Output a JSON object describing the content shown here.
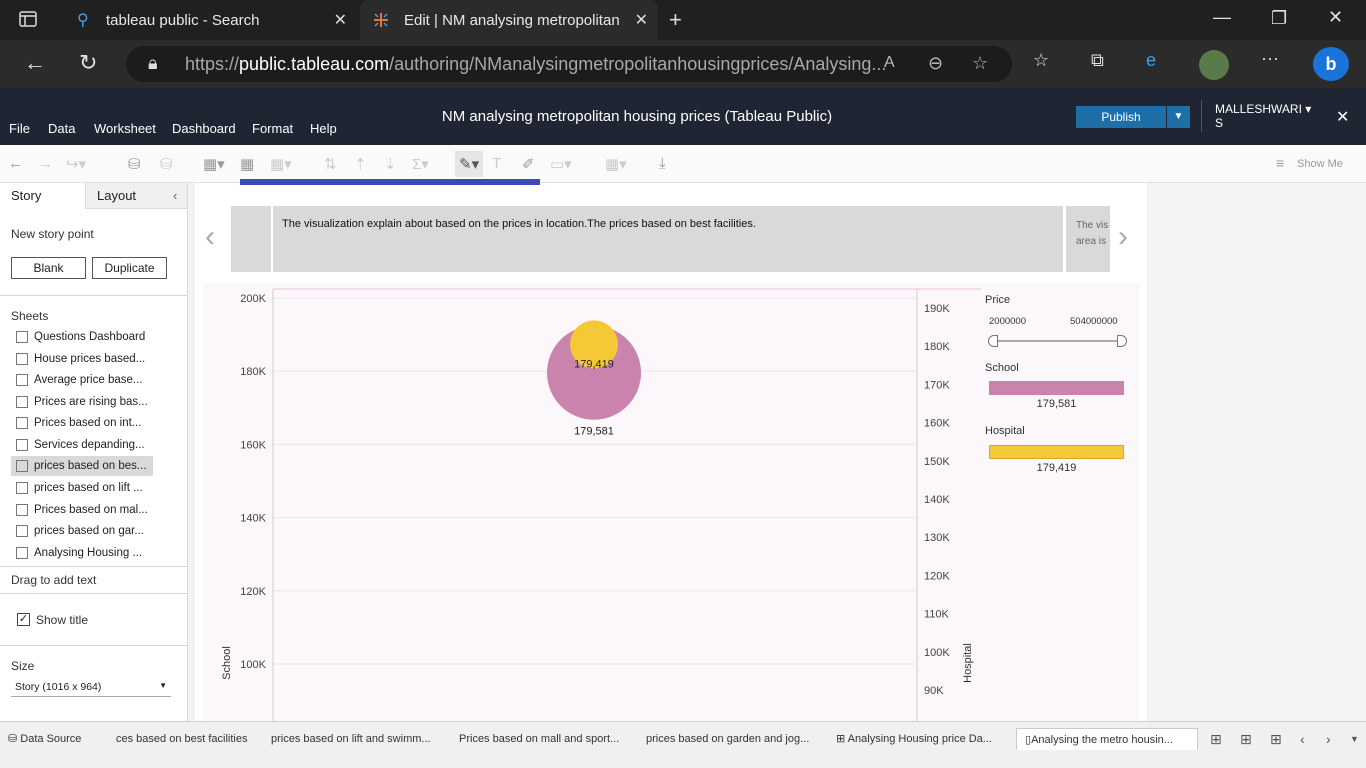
{
  "browser": {
    "tabs": [
      {
        "title": "tableau public - Search"
      },
      {
        "title": "Edit | NM analysing metropolitan"
      }
    ],
    "url_prefix": "https://",
    "url_host": "public.tableau.com",
    "url_path": "/authoring/NManalysingmetropolitanhousingprices/Analysing..."
  },
  "app": {
    "menus": [
      "File",
      "Data",
      "Worksheet",
      "Dashboard",
      "Format",
      "Help"
    ],
    "title": "NM analysing metropolitan housing prices (Tableau Public)",
    "publish_label": "Publish",
    "user_line1": "MALLESHWARI",
    "user_line2": "S",
    "show_me": "Show Me"
  },
  "left_pane": {
    "tab_story": "Story",
    "tab_layout": "Layout",
    "new_story_point": "New story point",
    "blank_label": "Blank",
    "duplicate_label": "Duplicate",
    "sheets_heading": "Sheets",
    "sheets": [
      "Questions Dashboard",
      "House prices based...",
      "Average price base...",
      "Prices are rising bas...",
      "Prices based on int...",
      "Services depanding...",
      "prices based on bes...",
      "prices based on lift ...",
      "Prices based on mal...",
      "prices based on gar...",
      "Analysing Housing ..."
    ],
    "drag_text": "Drag to add text",
    "show_title": "Show title",
    "size_heading": "Size",
    "size_value": "Story (1016 x 964)"
  },
  "story": {
    "caption": "The visualization explain about based on the prices in location.The prices based on best facilities.",
    "next_caption_line1": "The vis",
    "next_caption_line2": "area is"
  },
  "chart_data": {
    "type": "scatter",
    "left_axis": {
      "label": "School",
      "ticks": [
        "200K",
        "180K",
        "160K",
        "140K",
        "120K",
        "100K"
      ],
      "range": [
        95000,
        200000
      ]
    },
    "right_axis": {
      "label": "Hospital",
      "ticks": [
        "190K",
        "180K",
        "170K",
        "160K",
        "150K",
        "140K",
        "130K",
        "120K",
        "110K",
        "100K",
        "90K"
      ],
      "range": [
        88000,
        190000
      ]
    },
    "points": [
      {
        "series": "School",
        "value": 179581,
        "label": "179,581",
        "color": "#c983ad"
      },
      {
        "series": "Hospital",
        "value": 179419,
        "label": "179,419",
        "color": "#f5c836"
      }
    ],
    "legend": {
      "price_title": "Price",
      "price_min": "2000000",
      "price_max": "504000000",
      "school_title": "School",
      "school_value": "179,581",
      "hospital_title": "Hospital",
      "hospital_value": "179,419"
    }
  },
  "bottom_tabs": [
    "Data Source",
    "ces based on best facilities",
    "prices based on lift and swimm...",
    "Prices based on mall and sport...",
    "prices based on garden and jog...",
    "Analysing Housing price Da...",
    "Analysing the metro housin..."
  ],
  "colors": {
    "school": "#c983ad",
    "hospital": "#f5c836",
    "header": "#1f2533",
    "publish": "#1e6fa8"
  }
}
